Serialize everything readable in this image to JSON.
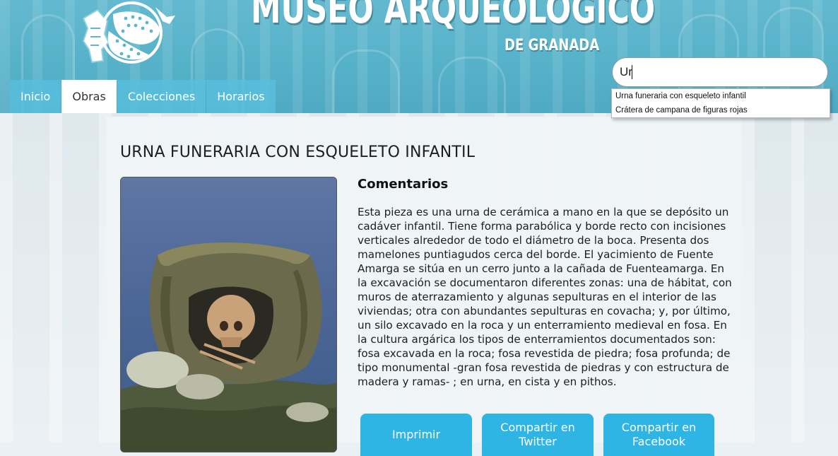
{
  "site": {
    "title_main": "MUSEO ARQUEOLÓGICO",
    "title_sub": "DE GRANADA"
  },
  "nav": {
    "tabs": [
      {
        "label": "Inicio",
        "active": false
      },
      {
        "label": "Obras",
        "active": true
      },
      {
        "label": "Colecciones",
        "active": false
      },
      {
        "label": "Horarios",
        "active": false
      }
    ]
  },
  "search": {
    "value": "Ur",
    "suggestions": [
      "Urna funeraria con esqueleto infantil",
      "Crátera de campana de figuras rojas"
    ]
  },
  "piece": {
    "title": "URNA FUNERARIA CON ESQUELETO INFANTIL",
    "comments_heading": "Comentarios",
    "comments_text": "Esta pieza es una urna de cerámica a mano en la que se depósito un cadáver infantil. Tiene forma parabólica y borde recto con incisiones verticales alrededor de todo el diámetro de la boca. Presenta dos mamelones puntiagudos cerca del borde. El yacimiento de Fuente Amarga se sitúa en un cerro junto a la cañada de Fuenteamarga. En la excavación se documentaron diferentes zonas: una de hábitat, con muros de aterrazamiento y algunas sepulturas en el interior de las viviendas; otra con abundantes sepulturas en covacha; y, por último, un silo excavado en la roca y un enterramiento medieval en fosa. En la cultura argárica los tipos de enterramientos documentados son: fosa excavada en la roca; fosa revestida de piedra; fosa profunda; de tipo monumental -gran fosa revestida de piedras y con estructura de madera y ramas- ; en urna, en cista y en pithos."
  },
  "actions": {
    "print": "Imprimir",
    "twitter": "Compartir en Twitter",
    "facebook": "Compartir en Facebook"
  },
  "colors": {
    "header": "#56b2c9",
    "tab": "#58bedc",
    "button": "#2fb5e4"
  }
}
